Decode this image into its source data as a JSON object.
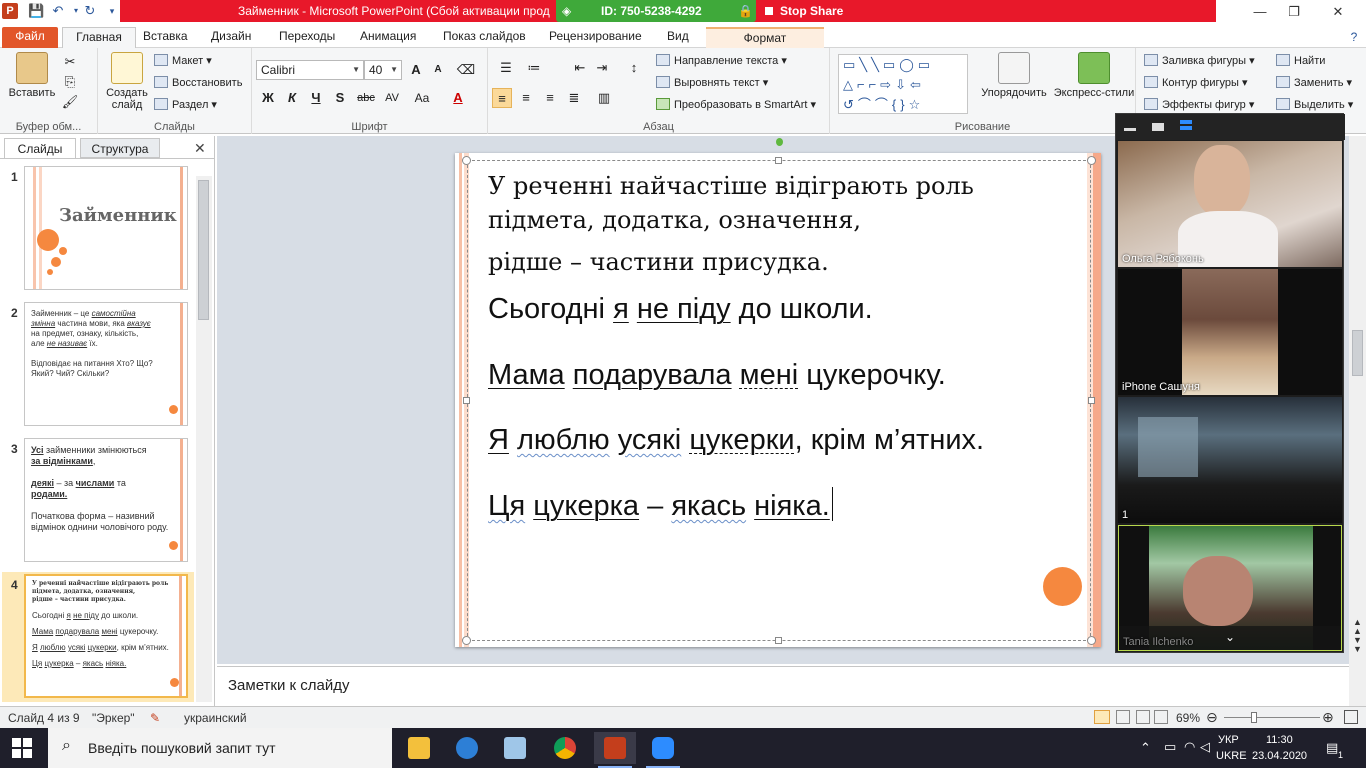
{
  "window": {
    "title": "Займенник  -  Microsoft PowerPoint (Сбой активации прод",
    "minimize_glyph": "—",
    "restore_glyph": "❐",
    "close_glyph": "✕"
  },
  "share_bar": {
    "meeting_id": "ID: 750-5238-4292",
    "stop_label": "Stop Share"
  },
  "ribbon_tabs": [
    "Файл",
    "Главная",
    "Вставка",
    "Дизайн",
    "Переходы",
    "Анимация",
    "Показ слайдов",
    "Рецензирование",
    "Вид",
    "Формат"
  ],
  "ribbon": {
    "clipboard": {
      "label": "Буфер обм...",
      "paste": "Вставить"
    },
    "slides": {
      "label": "Слайды",
      "new_slide": "Создать слайд",
      "layout": "Макет",
      "reset": "Восстановить",
      "section": "Раздел"
    },
    "font": {
      "label": "Шрифт",
      "font_name": "Calibri",
      "font_size": "40",
      "bold": "Ж",
      "italic": "К",
      "underline": "Ч",
      "shadow": "S",
      "strike": "abc",
      "spacing": "AV",
      "case": "Aa",
      "color": "A",
      "grow": "A",
      "shrink": "A"
    },
    "paragraph": {
      "label": "Абзац",
      "text_direction": "Направление текста",
      "align_text": "Выровнять текст",
      "smartart": "Преобразовать в SmartArt"
    },
    "drawing": {
      "label": "Рисование",
      "arrange": "Упорядочить",
      "quick_styles": "Экспресс-стили",
      "fill": "Заливка фигуры",
      "outline": "Контур фигуры",
      "effects": "Эффекты фигур"
    },
    "editing": {
      "find": "Найти",
      "replace": "Заменить",
      "select": "Выделить"
    }
  },
  "left_panel": {
    "tab_slides": "Слайды",
    "tab_outline": "Структура",
    "close_glyph": "✕",
    "slides": [
      {
        "num": "1",
        "title": "Займенник"
      },
      {
        "num": "2",
        "line1_a": "Займенник – це ",
        "line1_b": "самостійна",
        "line2_a": "змінна",
        "line2_b": " частина мови, яка ",
        "line2_c": "вказує",
        "line3": "на предмет, ознаку, кількість,",
        "line4_a": "але ",
        "line4_b": "не називає",
        "line4_c": " їх.",
        "line5": "Відповідає на питання Хто? Що?",
        "line6": "Який? Чий? Скільки?"
      },
      {
        "num": "3",
        "l1a": "Усі",
        "l1b": " займенники змінюються",
        "l2": "за відмінками",
        "l2b": ",",
        "l3a": "деякі",
        "l3b": " – за ",
        "l3c": "числами",
        "l3d": " та",
        "l4": "родами.",
        "l5": "Початкова форма – називний",
        "l6": "відмінок однини чоловічого роду."
      },
      {
        "num": "4",
        "l1": "У реченні найчастіше відіграють роль",
        "l2": "підмета, додатка, означення,",
        "l3": "рідше – частини присудка.",
        "l4a": "Сьогодні ",
        "l4b": "я",
        "l4c": " ",
        "l4d": "не піду",
        "l4e": " до школи.",
        "l5a": "Мама",
        "l5b": " ",
        "l5c": "подарувала",
        "l5d": " ",
        "l5e": "мені",
        "l5f": " цукерочку.",
        "l6a": "Я",
        "l6b": " ",
        "l6c": "люблю",
        "l6d": " ",
        "l6e": "усякі",
        "l6f": " ",
        "l6g": "цукерки",
        "l6h": ", крім м’ятних.",
        "l7a": "Ця",
        "l7b": " ",
        "l7c": "цукерка",
        "l7d": " – ",
        "l7e": "якась",
        "l7f": " ",
        "l7g": "ніяка."
      }
    ]
  },
  "slide": {
    "intro1": "У реченні найчастіше відіграють роль",
    "intro2": "підмета, додатка, означення,",
    "intro3": "рідше – частини присудка.",
    "s1": {
      "a": "Сьогодні ",
      "b": "я",
      "c": " ",
      "d": "не піду",
      "e": " до школи."
    },
    "s2": {
      "a": "Мама",
      "b": " ",
      "c": "подарувала",
      "d": " ",
      "e": "мені",
      "f": " цукерочку."
    },
    "s3": {
      "a": "Я",
      "b": " ",
      "c": "люблю",
      "d": " ",
      "e": "усякі",
      "f": " ",
      "g": "цукерки",
      "h": ", крім м’ятних."
    },
    "s4": {
      "a": "Ця",
      "b": " ",
      "c": "цукерка",
      "d": " – ",
      "e": "якась",
      "f": " ",
      "g": "ніяка."
    }
  },
  "notes_placeholder": "Заметки к слайду",
  "participants": [
    {
      "name": "Ольга Рябоконь"
    },
    {
      "name": "iPhone Сашуня"
    },
    {
      "name": "1"
    },
    {
      "name": "Tania Ilchenko"
    }
  ],
  "status": {
    "slide_info": "Слайд 4 из 9",
    "theme": "\"Эркер\"",
    "language": "украинский",
    "zoom": "69%"
  },
  "taskbar": {
    "search_placeholder": "Введіть пошуковий запит тут",
    "lang1": "УКР",
    "lang2": "UKRE",
    "time": "11:30",
    "date": "23.04.2020",
    "notifications": "1"
  },
  "colors": {
    "title_red": "#e8182a",
    "share_green": "#3fa93a",
    "file_tab": "#e2562a",
    "accent_orange": "#f5883f",
    "taskbar": "#1f1f2b"
  }
}
